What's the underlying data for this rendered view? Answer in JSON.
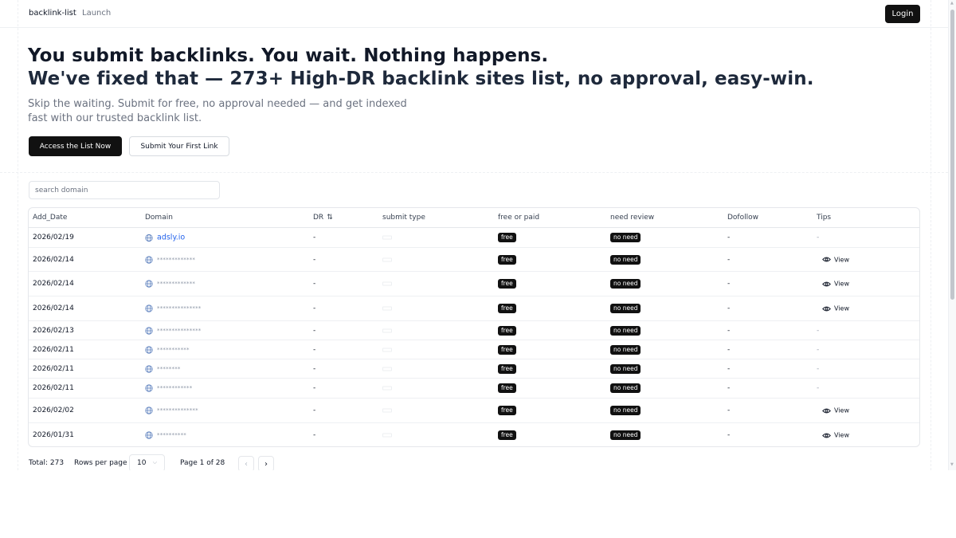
{
  "nav": {
    "brand": "backlink-list",
    "launch": "Launch",
    "login": "Login"
  },
  "hero": {
    "title_line1": "You submit backlinks. You wait. Nothing happens.",
    "title_line2": "We've fixed that — 273+ High-DR backlink sites list, no approval, easy-win.",
    "subtitle": "Skip the waiting. Submit for free, no approval needed — and get indexed fast with our trusted backlink list.",
    "primary_button": "Access the List Now",
    "secondary_button": "Submit Your First Link"
  },
  "search": {
    "placeholder": "search domain"
  },
  "table": {
    "headers": {
      "add_date": "Add_Date",
      "domain": "Domain",
      "dr": "DR",
      "submit_type": "submit type",
      "free_or_paid": "free or paid",
      "need_review": "need review",
      "dofollow": "Dofollow",
      "tips": "Tips"
    },
    "rows": [
      {
        "date": "2026/02/19",
        "domain": "adsly.io",
        "dr": "-",
        "free": "free",
        "review": "no need",
        "dofollow": "-",
        "tips": "-"
      },
      {
        "date": "2026/02/14",
        "domain": "*************",
        "dr": "-",
        "free": "free",
        "review": "no need",
        "dofollow": "-",
        "tips": "View"
      },
      {
        "date": "2026/02/14",
        "domain": "*************",
        "dr": "-",
        "free": "free",
        "review": "no need",
        "dofollow": "-",
        "tips": "View"
      },
      {
        "date": "2026/02/14",
        "domain": "***************",
        "dr": "-",
        "free": "free",
        "review": "no need",
        "dofollow": "-",
        "tips": "View"
      },
      {
        "date": "2026/02/13",
        "domain": "***************",
        "dr": "-",
        "free": "free",
        "review": "no need",
        "dofollow": "-",
        "tips": "-"
      },
      {
        "date": "2026/02/11",
        "domain": "***********",
        "dr": "-",
        "free": "free",
        "review": "no need",
        "dofollow": "-",
        "tips": "-"
      },
      {
        "date": "2026/02/11",
        "domain": "********",
        "dr": "-",
        "free": "free",
        "review": "no need",
        "dofollow": "-",
        "tips": "-"
      },
      {
        "date": "2026/02/11",
        "domain": "************",
        "dr": "-",
        "free": "free",
        "review": "no need",
        "dofollow": "-",
        "tips": "-"
      },
      {
        "date": "2026/02/02",
        "domain": "**************",
        "dr": "-",
        "free": "free",
        "review": "no need",
        "dofollow": "-",
        "tips": "View"
      },
      {
        "date": "2026/01/31",
        "domain": "**********",
        "dr": "-",
        "free": "free",
        "review": "no need",
        "dofollow": "-",
        "tips": "View"
      }
    ]
  },
  "pagination": {
    "total": "Total: 273",
    "rows_per_page_label": "Rows per page",
    "rows_per_page_value": "10",
    "page_info": "Page 1 of 28"
  },
  "colors": {
    "primary": "#111111",
    "link": "#2563eb",
    "muted": "#6b7280"
  }
}
